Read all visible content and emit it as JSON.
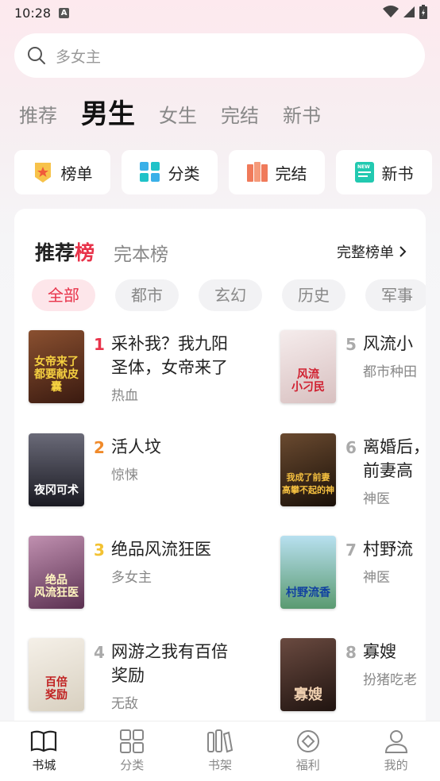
{
  "status_bar": {
    "time": "10:28",
    "notif_letter": "A"
  },
  "search": {
    "placeholder": "多女主"
  },
  "tabs": [
    {
      "label": "推荐",
      "active": false
    },
    {
      "label": "男生",
      "active": true
    },
    {
      "label": "女生",
      "active": false
    },
    {
      "label": "完结",
      "active": false
    },
    {
      "label": "新书",
      "active": false
    }
  ],
  "shortcuts": [
    {
      "label": "榜单",
      "icon": "medal-icon"
    },
    {
      "label": "分类",
      "icon": "grid-icon"
    },
    {
      "label": "完结",
      "icon": "books-icon"
    },
    {
      "label": "新书",
      "icon": "new-book-icon"
    }
  ],
  "ranking": {
    "tab_active_prefix": "推荐",
    "tab_active_suffix": "榜",
    "tab_other": "完本榜",
    "full_list_label": "完整榜单",
    "genres": [
      "全部",
      "都市",
      "玄幻",
      "历史",
      "军事"
    ],
    "books": [
      {
        "rank": "1",
        "title": "采补我？我九阳\n圣体，女帝来了",
        "tag": "热血",
        "cover_text": "女帝来了\n都要献皮囊",
        "cover_color": "#5a2a1a"
      },
      {
        "rank": "2",
        "title": "活人坟",
        "tag": "惊悚",
        "cover_text": "夜冈可术",
        "cover_color": "#2b2a33"
      },
      {
        "rank": "3",
        "title": "绝品风流狂医",
        "tag": "多女主",
        "cover_text": "绝品\n风流狂医",
        "cover_color": "#7a4a6a"
      },
      {
        "rank": "4",
        "title": "网游之我有百倍\n奖励",
        "tag": "无敌",
        "cover_text": "百倍\n奖励",
        "cover_color": "#e9e4da"
      },
      {
        "rank": "5",
        "title": "风流小",
        "tag": "都市种田",
        "cover_text": "风流\n小刁民",
        "cover_color": "#e8d8d8"
      },
      {
        "rank": "6",
        "title": "离婚后，\n前妻高",
        "tag": "神医",
        "cover_text": "我成了前妻\n高攀不起的神",
        "cover_color": "#3a2a20"
      },
      {
        "rank": "7",
        "title": "村野流",
        "tag": "神医",
        "cover_text": "村野流香",
        "cover_color": "#8ab8c8"
      },
      {
        "rank": "8",
        "title": "寡嫂",
        "tag": "扮猪吃老",
        "cover_text": "寡嫂",
        "cover_color": "#3a2420"
      }
    ]
  },
  "bottom_nav": [
    {
      "label": "书城",
      "icon": "book-open-icon",
      "active": true
    },
    {
      "label": "分类",
      "icon": "category-icon",
      "active": false
    },
    {
      "label": "书架",
      "icon": "bookshelf-icon",
      "active": false
    },
    {
      "label": "福利",
      "icon": "coin-icon",
      "active": false
    },
    {
      "label": "我的",
      "icon": "user-icon",
      "active": false
    }
  ],
  "colors": {
    "accent": "#e8334a",
    "rank2": "#f08a2a",
    "rank3": "#f3c232"
  }
}
